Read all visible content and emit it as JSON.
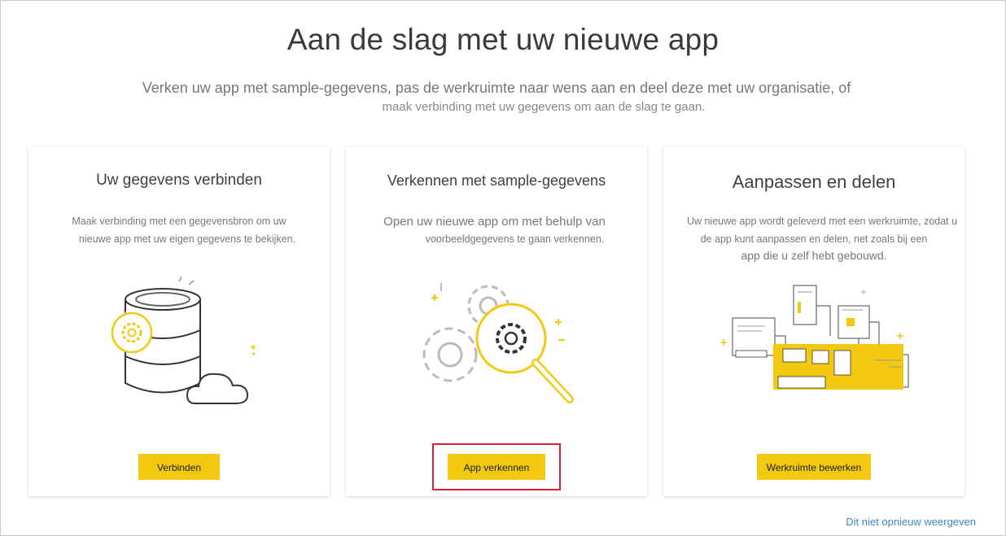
{
  "header": {
    "title": "Aan de slag met uw nieuwe app",
    "subtitle_line1": "Verken uw app met sample-gegevens, pas de werkruimte naar wens aan en deel deze met uw organisatie, of",
    "subtitle_line2": "maak verbinding met uw gegevens om aan de slag te gaan."
  },
  "cards": [
    {
      "title": "Uw gegevens verbinden",
      "desc_line1": "Maak verbinding met een gegevensbron om uw",
      "desc_line2": "nieuwe app met uw eigen gegevens te bekijken.",
      "button": "Verbinden",
      "icon": "database-cloud-icon"
    },
    {
      "title": "Verkennen met sample-gegevens",
      "desc_line1": "Open uw nieuwe app om met behulp van",
      "desc_line2": "voorbeeldgegevens te gaan verkennen.",
      "button": "App verkennen",
      "icon": "magnifier-gears-icon"
    },
    {
      "title": "Aanpassen en delen",
      "desc_line1": "Uw nieuwe app wordt geleverd met een werkruimte, zodat u",
      "desc_line2": "de app kunt aanpassen en delen, net zoals bij een",
      "desc_line3": "app die u zelf hebt gebouwd.",
      "button": "Werkruimte bewerken",
      "icon": "dashboard-share-icon"
    }
  ],
  "footer": {
    "link": "Dit niet opnieuw weergeven"
  },
  "colors": {
    "accent": "#f2c811",
    "highlight": "#d82039",
    "link": "#3a87c6"
  }
}
